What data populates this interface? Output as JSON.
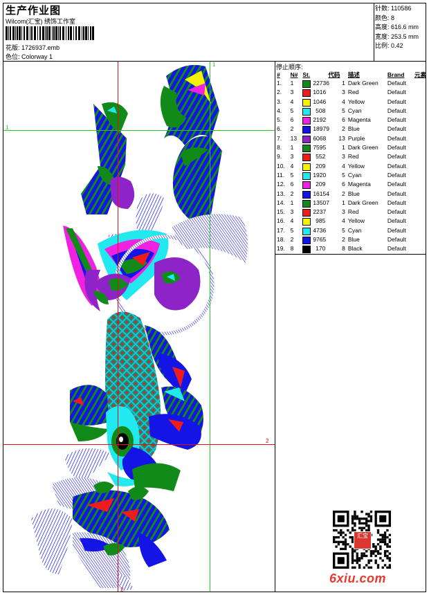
{
  "header": {
    "title": "生产作业图",
    "subtitle": "Wilcom(汇宝) 绣饰工作室",
    "filename_label": "花版:",
    "filename": "1726937.emb",
    "colorway_label": "色位:",
    "colorway": "Colorway 1"
  },
  "stats": [
    {
      "label": "针数:",
      "value": "110586"
    },
    {
      "label": "颜色:",
      "value": "8"
    },
    {
      "label": "高度:",
      "value": "616.6 mm"
    },
    {
      "label": "宽度:",
      "value": "253.5 mm"
    },
    {
      "label": "比例:",
      "value": "0.42"
    }
  ],
  "sequence": {
    "title": "停止顺序:",
    "headers": [
      "#",
      "N#",
      "St.",
      "代码",
      "描述",
      "Brand",
      "元素"
    ],
    "rows": [
      {
        "idx": "1.",
        "n": "1",
        "color": "#128a1a",
        "st": "22736",
        "code": "1",
        "desc": "Dark Green",
        "brand": "Default"
      },
      {
        "idx": "2.",
        "n": "3",
        "color": "#ee1c1c",
        "st": "1016",
        "code": "3",
        "desc": "Red",
        "brand": "Default"
      },
      {
        "idx": "3.",
        "n": "4",
        "color": "#f6f200",
        "st": "1046",
        "code": "4",
        "desc": "Yellow",
        "brand": "Default"
      },
      {
        "idx": "4.",
        "n": "5",
        "color": "#22e8f0",
        "st": "508",
        "code": "5",
        "desc": "Cyan",
        "brand": "Default"
      },
      {
        "idx": "5.",
        "n": "6",
        "color": "#ee22e0",
        "st": "2192",
        "code": "6",
        "desc": "Magenta",
        "brand": "Default"
      },
      {
        "idx": "6.",
        "n": "2",
        "color": "#1414e6",
        "st": "18979",
        "code": "2",
        "desc": "Blue",
        "brand": "Default"
      },
      {
        "idx": "7.",
        "n": "13",
        "color": "#8e24c8",
        "st": "6068",
        "code": "13",
        "desc": "Purple",
        "brand": "Default"
      },
      {
        "idx": "8.",
        "n": "1",
        "color": "#128a1a",
        "st": "7595",
        "code": "1",
        "desc": "Dark Green",
        "brand": "Default"
      },
      {
        "idx": "9.",
        "n": "3",
        "color": "#ee1c1c",
        "st": "552",
        "code": "3",
        "desc": "Red",
        "brand": "Default"
      },
      {
        "idx": "10.",
        "n": "4",
        "color": "#f6f200",
        "st": "209",
        "code": "4",
        "desc": "Yellow",
        "brand": "Default"
      },
      {
        "idx": "11.",
        "n": "5",
        "color": "#22e8f0",
        "st": "1920",
        "code": "5",
        "desc": "Cyan",
        "brand": "Default"
      },
      {
        "idx": "12.",
        "n": "6",
        "color": "#ee22e0",
        "st": "209",
        "code": "6",
        "desc": "Magenta",
        "brand": "Default"
      },
      {
        "idx": "13.",
        "n": "2",
        "color": "#1414e6",
        "st": "16154",
        "code": "2",
        "desc": "Blue",
        "brand": "Default"
      },
      {
        "idx": "14.",
        "n": "1",
        "color": "#128a1a",
        "st": "13507",
        "code": "1",
        "desc": "Dark Green",
        "brand": "Default"
      },
      {
        "idx": "15.",
        "n": "3",
        "color": "#ee1c1c",
        "st": "2237",
        "code": "3",
        "desc": "Red",
        "brand": "Default"
      },
      {
        "idx": "16.",
        "n": "4",
        "color": "#f6f200",
        "st": "985",
        "code": "4",
        "desc": "Yellow",
        "brand": "Default"
      },
      {
        "idx": "17.",
        "n": "5",
        "color": "#22e8f0",
        "st": "4736",
        "code": "5",
        "desc": "Cyan",
        "brand": "Default"
      },
      {
        "idx": "18.",
        "n": "2",
        "color": "#1414e6",
        "st": "9765",
        "code": "2",
        "desc": "Blue",
        "brand": "Default"
      },
      {
        "idx": "19.",
        "n": "8",
        "color": "#000000",
        "st": "170",
        "code": "8",
        "desc": "Black",
        "brand": "Default"
      }
    ]
  },
  "guides": {
    "vertical_1": "1",
    "horizontal_1": "1",
    "horizontal_2": "2",
    "vertical_2": "2",
    "guide_color_green": "#22cc22",
    "guide_color_red": "#dd1111"
  },
  "watermark": "6xiu.com",
  "qr_seal_text": "汇宝"
}
